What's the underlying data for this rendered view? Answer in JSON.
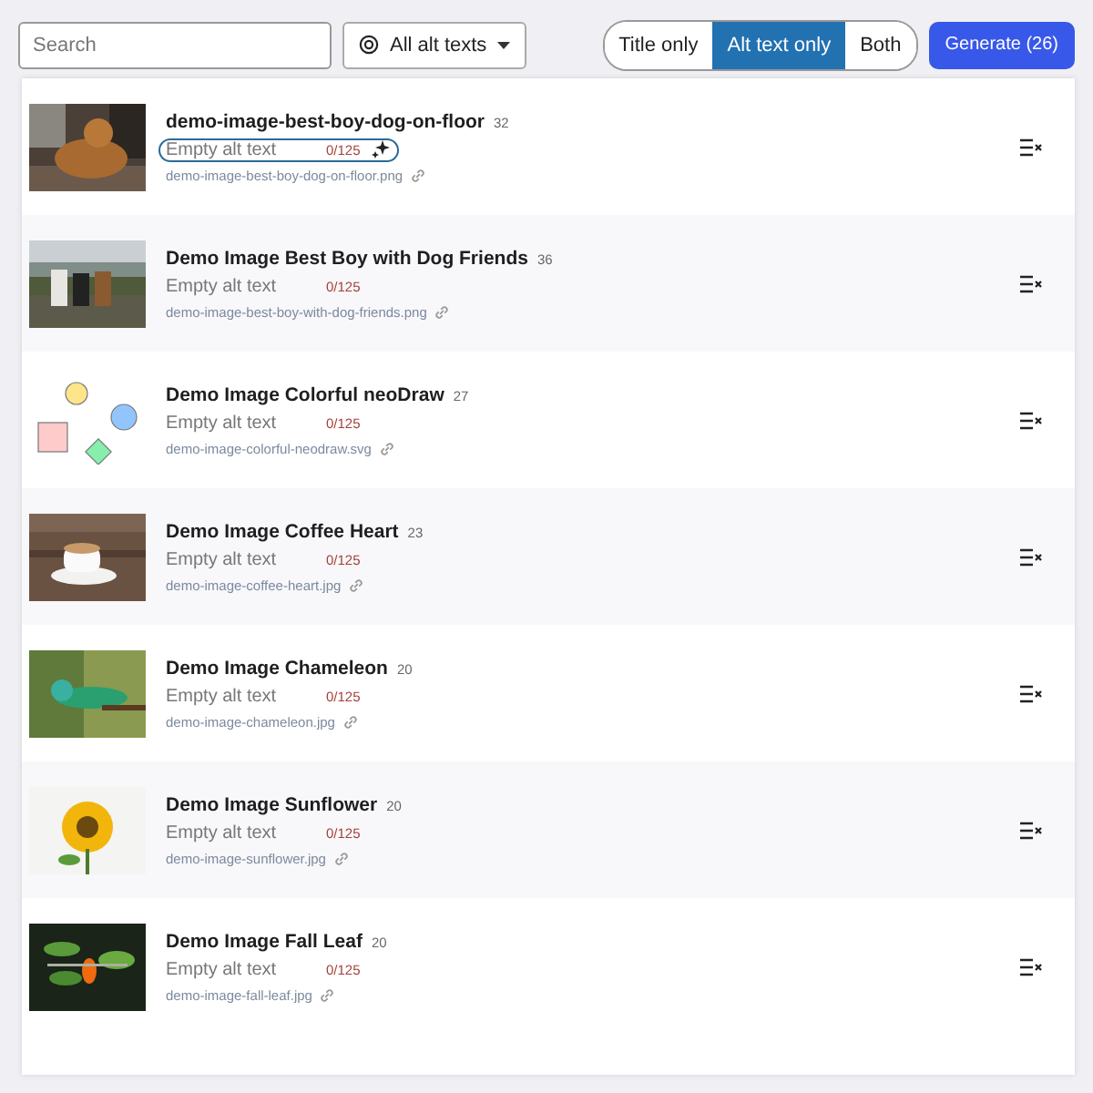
{
  "search": {
    "placeholder": "Search"
  },
  "filter": {
    "label": "All alt texts"
  },
  "modes": [
    {
      "label": "Title only",
      "selected": false
    },
    {
      "label": "Alt text only",
      "selected": true
    },
    {
      "label": "Both",
      "selected": false
    }
  ],
  "generate_button": "Generate (26)",
  "images": [
    {
      "title": "demo-image-best-boy-dog-on-floor",
      "count": "32",
      "alt_placeholder": "Empty alt text",
      "counter": "0/125",
      "filename": "demo-image-best-boy-dog-on-floor.png",
      "active": true
    },
    {
      "title": "Demo Image Best Boy with Dog Friends",
      "count": "36",
      "alt_placeholder": "Empty alt text",
      "counter": "0/125",
      "filename": "demo-image-best-boy-with-dog-friends.png",
      "active": false
    },
    {
      "title": "Demo Image Colorful neoDraw",
      "count": "27",
      "alt_placeholder": "Empty alt text",
      "counter": "0/125",
      "filename": "demo-image-colorful-neodraw.svg",
      "active": false
    },
    {
      "title": "Demo Image Coffee Heart",
      "count": "23",
      "alt_placeholder": "Empty alt text",
      "counter": "0/125",
      "filename": "demo-image-coffee-heart.jpg",
      "active": false
    },
    {
      "title": "Demo Image Chameleon",
      "count": "20",
      "alt_placeholder": "Empty alt text",
      "counter": "0/125",
      "filename": "demo-image-chameleon.jpg",
      "active": false
    },
    {
      "title": "Demo Image Sunflower",
      "count": "20",
      "alt_placeholder": "Empty alt text",
      "counter": "0/125",
      "filename": "demo-image-sunflower.jpg",
      "active": false
    },
    {
      "title": "Demo Image Fall Leaf",
      "count": "20",
      "alt_placeholder": "Empty alt text",
      "counter": "0/125",
      "filename": "demo-image-fall-leaf.jpg",
      "active": false
    }
  ]
}
